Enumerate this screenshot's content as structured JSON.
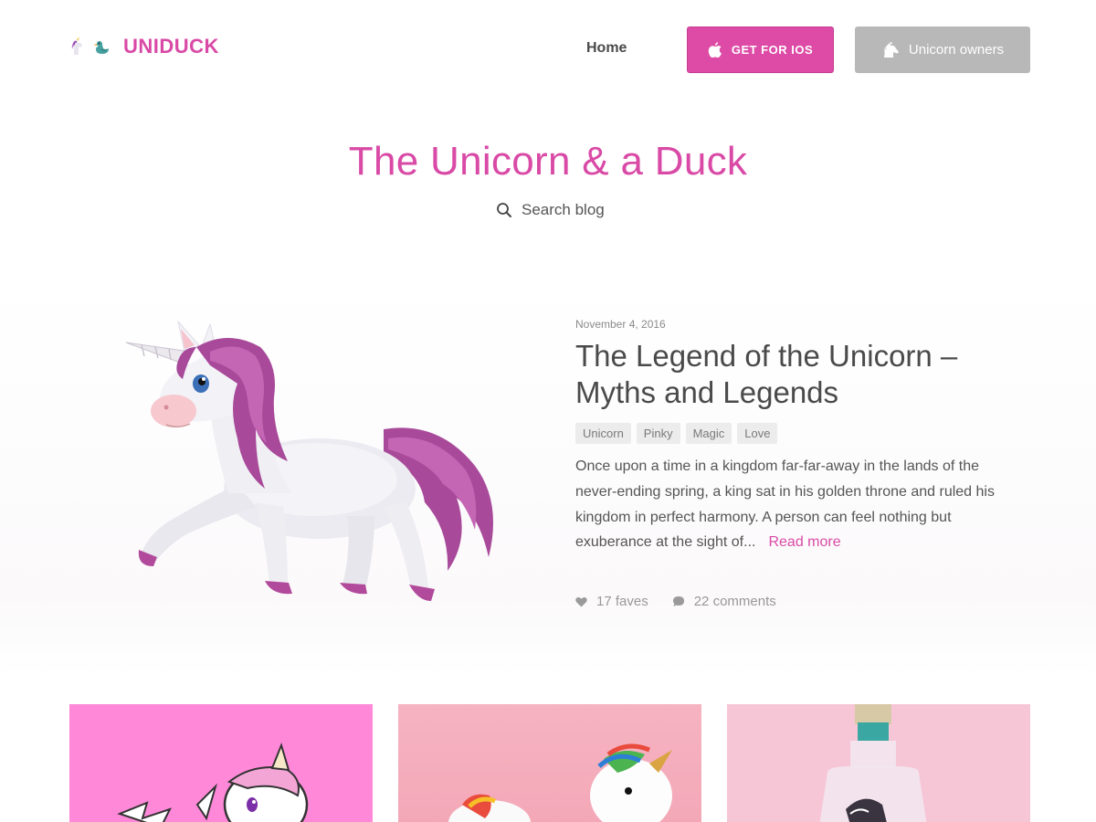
{
  "header": {
    "logo_text": "UNIDUCK",
    "logo_icons": [
      "unicorn-icon",
      "duck-icon"
    ],
    "nav_home": "Home",
    "btn_ios": "GET FOR IOS",
    "btn_owners": "Unicorn owners"
  },
  "hero": {
    "title": "The Unicorn & a Duck",
    "search_placeholder": "Search blog"
  },
  "featured": {
    "date": "November 4, 2016",
    "title": "The Legend of the Unicorn – Myths and Legends",
    "tags": [
      "Unicorn",
      "Pinky",
      "Magic",
      "Love"
    ],
    "excerpt": "Once upon a time in a kingdom far-far-away in the lands of the never-ending spring, a king sat in his golden throne and ruled his kingdom in perfect harmony. A person can feel nothing but exuberance at the sight of...",
    "read_more": "Read more",
    "faves": "17 faves",
    "comments": "22 comments"
  },
  "colors": {
    "brand_pink": "#d94aa6",
    "button_pink": "#dd4ba6",
    "button_gray": "#b8b8b8",
    "card_1_bg": "#ff89d8",
    "card_2_bg": "#f3a7b7",
    "card_3_bg": "#f7c6d6"
  }
}
